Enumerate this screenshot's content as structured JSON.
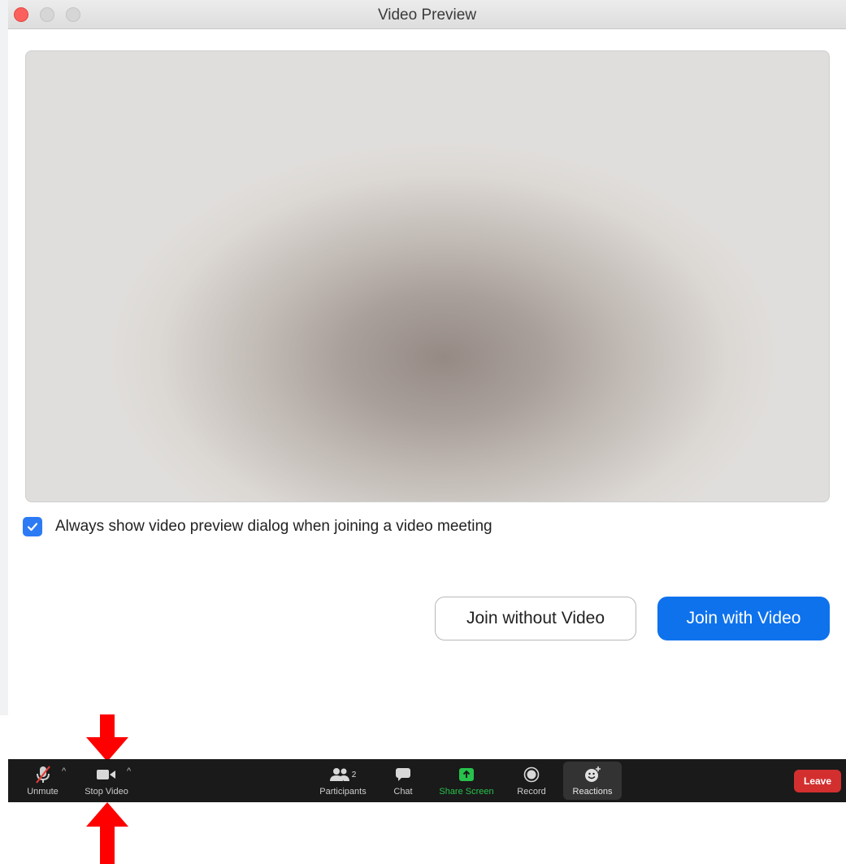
{
  "window": {
    "title": "Video Preview"
  },
  "preview": {
    "checkbox_label": "Always show video preview dialog when joining a video meeting",
    "checkbox_checked": true,
    "join_without_video_label": "Join without Video",
    "join_with_video_label": "Join with Video"
  },
  "toolbar": {
    "unmute_label": "Unmute",
    "stop_video_label": "Stop Video",
    "participants_label": "Participants",
    "participants_count": "2",
    "chat_label": "Chat",
    "share_screen_label": "Share Screen",
    "record_label": "Record",
    "reactions_label": "Reactions",
    "leave_label": "Leave"
  },
  "colors": {
    "primary_blue": "#0e72ed",
    "checkbox_blue": "#2d7bf4",
    "share_green": "#27c24c",
    "leave_red": "#d32f2f",
    "arrow_red": "#ff0000",
    "toolbar_bg": "#1a1a1a"
  },
  "icons": {
    "close": "close-icon",
    "minimize": "minimize-icon",
    "zoom": "zoom-icon",
    "mic_muted": "microphone-muted-icon",
    "video": "video-camera-icon",
    "participants": "participants-icon",
    "chat": "chat-bubble-icon",
    "share": "share-screen-icon",
    "record": "record-icon",
    "reactions": "smiley-icon",
    "annotation_arrow": "red-arrow-icon"
  }
}
